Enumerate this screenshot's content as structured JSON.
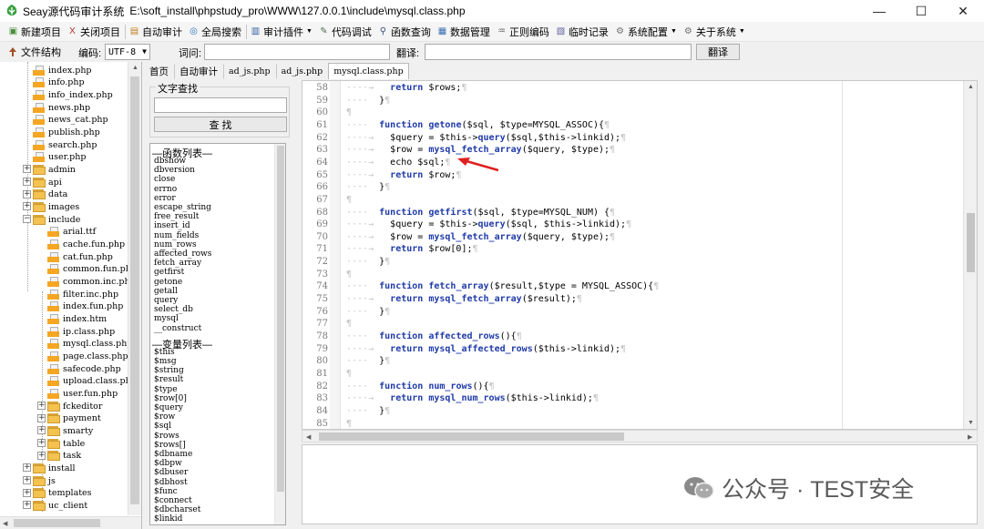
{
  "window": {
    "app_name": "Seay源代码审计系统",
    "path": "E:\\soft_install\\phpstudy_pro\\WWW\\127.0.0.1\\include\\mysql.class.php",
    "minimize": "—",
    "maximize": "☐",
    "close": "✕"
  },
  "toolbar": {
    "items": [
      {
        "label": "新建项目",
        "icon": "new-project-icon"
      },
      {
        "label": "关闭项目",
        "icon": "close-project-icon"
      },
      {
        "label": "自动审计",
        "icon": "auto-audit-icon"
      },
      {
        "label": "全局搜索",
        "icon": "global-search-icon"
      },
      {
        "label": "审计插件",
        "icon": "plugin-icon"
      },
      {
        "label": "代码调试",
        "icon": "debug-icon"
      },
      {
        "label": "函数查询",
        "icon": "function-query-icon"
      },
      {
        "label": "数据管理",
        "icon": "data-manage-icon"
      },
      {
        "label": "正则编码",
        "icon": "regex-encode-icon"
      },
      {
        "label": "临时记录",
        "icon": "temp-record-icon"
      },
      {
        "label": "系统配置",
        "icon": "settings-icon"
      },
      {
        "label": "关于系统",
        "icon": "about-icon"
      }
    ]
  },
  "searchbar": {
    "file_structure": "文件结构",
    "encoding_label": "编码:",
    "encoding_value": "UTF-8",
    "word_label": "词问:",
    "word_value": "",
    "translate_label": "翻译:",
    "translate_value": "",
    "translate_button": "翻译"
  },
  "file_tree": {
    "items": [
      {
        "name": "index.php",
        "type": "file",
        "depth": 1
      },
      {
        "name": "info.php",
        "type": "file",
        "depth": 1
      },
      {
        "name": "info_index.php",
        "type": "file",
        "depth": 1
      },
      {
        "name": "news.php",
        "type": "file",
        "depth": 1
      },
      {
        "name": "news_cat.php",
        "type": "file",
        "depth": 1
      },
      {
        "name": "publish.php",
        "type": "file",
        "depth": 1
      },
      {
        "name": "search.php",
        "type": "file",
        "depth": 1
      },
      {
        "name": "user.php",
        "type": "file",
        "depth": 1
      },
      {
        "name": "admin",
        "type": "folder",
        "depth": 1,
        "expander": "+"
      },
      {
        "name": "api",
        "type": "folder",
        "depth": 1,
        "expander": "+"
      },
      {
        "name": "data",
        "type": "folder",
        "depth": 1,
        "expander": "+"
      },
      {
        "name": "images",
        "type": "folder",
        "depth": 1,
        "expander": "+"
      },
      {
        "name": "include",
        "type": "folder",
        "depth": 1,
        "expander": "−"
      },
      {
        "name": "arial.ttf",
        "type": "file",
        "depth": 2
      },
      {
        "name": "cache.fun.php",
        "type": "file",
        "depth": 2
      },
      {
        "name": "cat.fun.php",
        "type": "file",
        "depth": 2
      },
      {
        "name": "common.fun.php",
        "type": "file",
        "depth": 2
      },
      {
        "name": "common.inc.php",
        "type": "file",
        "depth": 2
      },
      {
        "name": "filter.inc.php",
        "type": "file",
        "depth": 2
      },
      {
        "name": "index.fun.php",
        "type": "file",
        "depth": 2
      },
      {
        "name": "index.htm",
        "type": "file",
        "depth": 2
      },
      {
        "name": "ip.class.php",
        "type": "file",
        "depth": 2
      },
      {
        "name": "mysql.class.php",
        "type": "file",
        "depth": 2
      },
      {
        "name": "page.class.php",
        "type": "file",
        "depth": 2
      },
      {
        "name": "safecode.php",
        "type": "file",
        "depth": 2
      },
      {
        "name": "upload.class.php",
        "type": "file",
        "depth": 2
      },
      {
        "name": "user.fun.php",
        "type": "file",
        "depth": 2
      },
      {
        "name": "fckeditor",
        "type": "folder",
        "depth": 2,
        "expander": "+"
      },
      {
        "name": "payment",
        "type": "folder",
        "depth": 2,
        "expander": "+"
      },
      {
        "name": "smarty",
        "type": "folder",
        "depth": 2,
        "expander": "+"
      },
      {
        "name": "table",
        "type": "folder",
        "depth": 2,
        "expander": "+"
      },
      {
        "name": "task",
        "type": "folder",
        "depth": 2,
        "expander": "+"
      },
      {
        "name": "install",
        "type": "folder",
        "depth": 1,
        "expander": "+"
      },
      {
        "name": "js",
        "type": "folder",
        "depth": 1,
        "expander": "+"
      },
      {
        "name": "templates",
        "type": "folder",
        "depth": 1,
        "expander": "+"
      },
      {
        "name": "uc_client",
        "type": "folder",
        "depth": 1,
        "expander": "+"
      }
    ]
  },
  "tabs": [
    {
      "label": "首页",
      "mono": false,
      "active": false
    },
    {
      "label": "自动审计",
      "mono": false,
      "active": false
    },
    {
      "label": "ad_js.php",
      "mono": true,
      "active": false
    },
    {
      "label": "ad_js.php",
      "mono": true,
      "active": false
    },
    {
      "label": "mysql.class.php",
      "mono": true,
      "active": true
    }
  ],
  "text_search": {
    "title": "文字查找",
    "input_value": "",
    "button": "查 找"
  },
  "function_list": {
    "heading": "—函数列表—",
    "items": [
      "dbshow",
      "dbversion",
      "close",
      "errno",
      "error",
      "escape_string",
      "free_result",
      "insert_id",
      "num_fields",
      "num_rows",
      "affected_rows",
      "fetch_array",
      "getfirst",
      "getone",
      "getall",
      "query",
      "select_db",
      "mysql",
      "__construct"
    ]
  },
  "variable_list": {
    "heading": "—变量列表—",
    "items": [
      "$this",
      "$msg",
      "$string",
      "$result",
      "$type",
      "$row[0]",
      "$query",
      "$row",
      "$sql",
      "$rows",
      "$rows[]",
      "$dbname",
      "$dbpw",
      "$dbuser",
      "$dbhost",
      "$func",
      "$connect",
      "$dbcharset",
      "$linkid"
    ]
  },
  "editor": {
    "lines": [
      {
        "n": "58",
        "indent": 2,
        "code": [
          [
            "kw",
            "return"
          ],
          [
            "txt",
            " $rows;"
          ]
        ]
      },
      {
        "n": "59",
        "indent": 1,
        "code": [
          [
            "txt",
            "}"
          ]
        ]
      },
      {
        "n": "60",
        "indent": 0,
        "code": []
      },
      {
        "n": "61",
        "indent": 1,
        "code": [
          [
            "kw",
            "function"
          ],
          [
            "txt",
            " "
          ],
          [
            "fn",
            "getone"
          ],
          [
            "txt",
            "($sql, $type=MYSQL_ASSOC){"
          ]
        ]
      },
      {
        "n": "62",
        "indent": 2,
        "code": [
          [
            "txt",
            "$query = $this->"
          ],
          [
            "fn",
            "query"
          ],
          [
            "txt",
            "($sql,$this->linkid);"
          ]
        ]
      },
      {
        "n": "63",
        "indent": 2,
        "code": [
          [
            "txt",
            "$row = "
          ],
          [
            "fn",
            "mysql_fetch_array"
          ],
          [
            "txt",
            "($query, $type);"
          ]
        ]
      },
      {
        "n": "64",
        "indent": 2,
        "code": [
          [
            "txt",
            "echo $sql;"
          ]
        ]
      },
      {
        "n": "65",
        "indent": 2,
        "code": [
          [
            "kw",
            "return"
          ],
          [
            "txt",
            " $row;"
          ]
        ]
      },
      {
        "n": "66",
        "indent": 1,
        "code": [
          [
            "txt",
            "}"
          ]
        ]
      },
      {
        "n": "67",
        "indent": 0,
        "code": []
      },
      {
        "n": "68",
        "indent": 1,
        "code": [
          [
            "kw",
            "function"
          ],
          [
            "txt",
            " "
          ],
          [
            "fn",
            "getfirst"
          ],
          [
            "txt",
            "($sql, $type=MYSQL_NUM) {"
          ]
        ]
      },
      {
        "n": "69",
        "indent": 2,
        "code": [
          [
            "txt",
            "$query = $this->"
          ],
          [
            "fn",
            "query"
          ],
          [
            "txt",
            "($sql, $this->linkid);"
          ]
        ]
      },
      {
        "n": "70",
        "indent": 2,
        "code": [
          [
            "txt",
            "$row = "
          ],
          [
            "fn",
            "mysql_fetch_array"
          ],
          [
            "txt",
            "($query, $type);"
          ]
        ]
      },
      {
        "n": "71",
        "indent": 2,
        "code": [
          [
            "kw",
            "return"
          ],
          [
            "txt",
            " $row[0];"
          ]
        ]
      },
      {
        "n": "72",
        "indent": 1,
        "code": [
          [
            "txt",
            "}"
          ]
        ]
      },
      {
        "n": "73",
        "indent": 0,
        "code": []
      },
      {
        "n": "74",
        "indent": 1,
        "code": [
          [
            "kw",
            "function"
          ],
          [
            "txt",
            " "
          ],
          [
            "fn",
            "fetch_array"
          ],
          [
            "txt",
            "($result,$type = MYSQL_ASSOC){"
          ]
        ]
      },
      {
        "n": "75",
        "indent": 2,
        "code": [
          [
            "kw",
            "return"
          ],
          [
            "txt",
            " "
          ],
          [
            "fn",
            "mysql_fetch_array"
          ],
          [
            "txt",
            "($result);"
          ]
        ]
      },
      {
        "n": "76",
        "indent": 1,
        "code": [
          [
            "txt",
            "}"
          ]
        ]
      },
      {
        "n": "77",
        "indent": 0,
        "code": []
      },
      {
        "n": "78",
        "indent": 1,
        "code": [
          [
            "kw",
            "function"
          ],
          [
            "txt",
            " "
          ],
          [
            "fn",
            "affected_rows"
          ],
          [
            "txt",
            "(){"
          ]
        ]
      },
      {
        "n": "79",
        "indent": 2,
        "code": [
          [
            "kw",
            "return"
          ],
          [
            "txt",
            " "
          ],
          [
            "fn",
            "mysql_affected_rows"
          ],
          [
            "txt",
            "($this->linkid);"
          ]
        ]
      },
      {
        "n": "80",
        "indent": 1,
        "code": [
          [
            "txt",
            "}"
          ]
        ]
      },
      {
        "n": "81",
        "indent": 0,
        "code": []
      },
      {
        "n": "82",
        "indent": 1,
        "code": [
          [
            "kw",
            "function"
          ],
          [
            "txt",
            " "
          ],
          [
            "fn",
            "num_rows"
          ],
          [
            "txt",
            "(){"
          ]
        ]
      },
      {
        "n": "83",
        "indent": 2,
        "code": [
          [
            "kw",
            "return"
          ],
          [
            "txt",
            " "
          ],
          [
            "fn",
            "mysql_num_rows"
          ],
          [
            "txt",
            "($this->linkid);"
          ]
        ]
      },
      {
        "n": "84",
        "indent": 1,
        "code": [
          [
            "txt",
            "}"
          ]
        ]
      },
      {
        "n": "85",
        "indent": 0,
        "code": []
      }
    ],
    "annotation_color": "#e02020"
  },
  "watermark": {
    "text": "公众号 · TEST安全"
  },
  "colors": {
    "keyword": "#1f3aa8",
    "arrow": "#e02020",
    "folder": "#f3c250",
    "file_bar": "#f5a623"
  }
}
